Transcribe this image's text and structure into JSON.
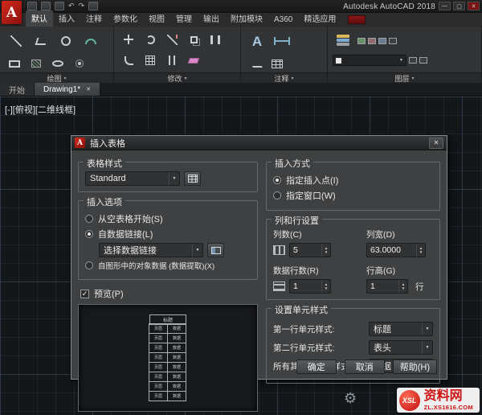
{
  "window": {
    "logo": "A",
    "title": "Autodesk AutoCAD 2018"
  },
  "icons": {
    "close": "✕",
    "minimize": "—",
    "maximize": "▢",
    "dropdown_arrow": "▼",
    "spinner_up": "▲",
    "spinner_down": "▼",
    "check": "✓",
    "gear": "⚙",
    "panel_arrow": "▾",
    "undo": "↶",
    "redo": "↷",
    "text_glyph": "A"
  },
  "ribbon": {
    "tabs": [
      {
        "label": "默认",
        "active": true
      },
      {
        "label": "插入"
      },
      {
        "label": "注释"
      },
      {
        "label": "参数化"
      },
      {
        "label": "视图"
      },
      {
        "label": "管理"
      },
      {
        "label": "输出"
      },
      {
        "label": "附加模块"
      },
      {
        "label": "A360"
      },
      {
        "label": "精选应用"
      }
    ],
    "panels": [
      {
        "label": "绘图"
      },
      {
        "label": "修改"
      },
      {
        "label": "注释"
      },
      {
        "label": "图层"
      }
    ]
  },
  "file_tabs": {
    "start": "开始",
    "drawing": "Drawing1*"
  },
  "viewport": {
    "label": "[-][俯视][二维线框]"
  },
  "dialog": {
    "title": "插入表格",
    "table_style": {
      "group": "表格样式",
      "value": "Standard"
    },
    "insert_options": {
      "group": "插入选项",
      "from_empty": "从空表格开始(S)",
      "from_link": "自数据链接(L)",
      "link_value": "选择数据链接",
      "from_object": "自图形中的对象数据 (数据提取)(X)"
    },
    "preview_label": "预览(P)",
    "preview": {
      "title": "标题",
      "header": "页眉",
      "data": "数据"
    },
    "insertion": {
      "group": "插入方式",
      "point": "指定插入点(I)",
      "window": "指定窗口(W)"
    },
    "col_row": {
      "group": "列和行设置",
      "columns_label": "列数(C)",
      "columns_value": "5",
      "width_label": "列宽(D)",
      "width_value": "63.0000",
      "rows_label": "数据行数(R)",
      "rows_value": "1",
      "height_label": "行高(G)",
      "height_value": "1",
      "height_unit": "行"
    },
    "cell_styles": {
      "group": "设置单元样式",
      "first_label": "第一行单元样式:",
      "first_value": "标题",
      "second_label": "第二行单元样式:",
      "second_value": "表头",
      "other_label": "所有其他行单元样式:",
      "other_value": "数据"
    },
    "buttons": {
      "ok": "确定",
      "cancel": "取消",
      "help": "帮助(H)"
    }
  },
  "watermark": {
    "logo": "XSL",
    "site": "资料网",
    "url": "ZL.XS1616.COM"
  },
  "colors": {
    "autocad_red": "#c21616",
    "watermark_red": "#cf1212",
    "dialog_bg": "#3e4042"
  }
}
